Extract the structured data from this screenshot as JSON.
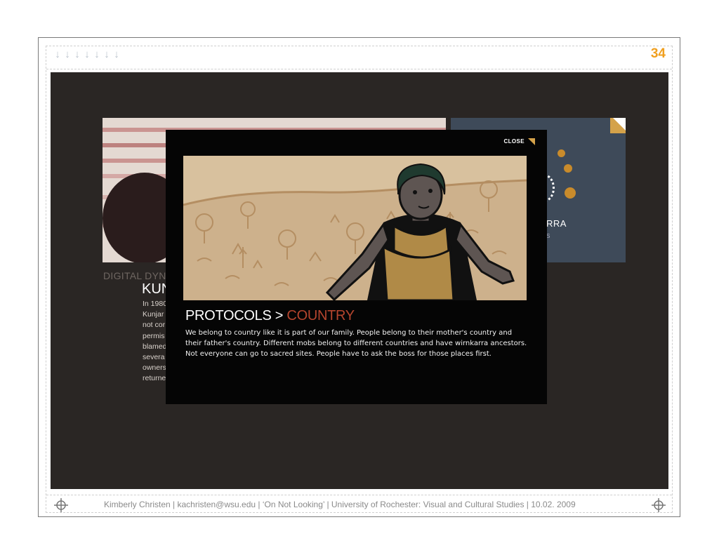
{
  "slide": {
    "page_number": "34",
    "nav_arrows": [
      "↓",
      "↓",
      "↓",
      "↓",
      "↓",
      "↓",
      "↓"
    ]
  },
  "background_cards": {
    "left_heading": "DIGITAL DYNA",
    "left_title": "KUN",
    "left_lines": [
      "In 1980",
      "Kunjar",
      "not cor",
      "permis",
      "blamed",
      "severa",
      "owners",
      "returne"
    ],
    "right_label": "RRA",
    "right_sub": "S"
  },
  "modal": {
    "close_label": "CLOSE",
    "title_prefix": "PROTOCOLS > ",
    "title_accent": "COUNTRY",
    "body": "We belong to country like it is part of our family.  People belong to their mother's country and their father's country.  Different mobs belong to different countries and have wirnkarra ancestors.  Not everyone can go to sacred sites.  People have to ask the boss for those places first.",
    "illustration_icon": "woman-in-country-illustration"
  },
  "footer": {
    "text": "Kimberly Christen | kachristen@wsu.edu | ‘On Not Looking’ | University of Rochester:  Visual and Cultural Studies | 10.02. 2009"
  },
  "colors": {
    "accent_orange": "#f0a020",
    "title_accent": "#b5452e",
    "background_dark": "#2a2624",
    "modal_bg": "#050505"
  }
}
